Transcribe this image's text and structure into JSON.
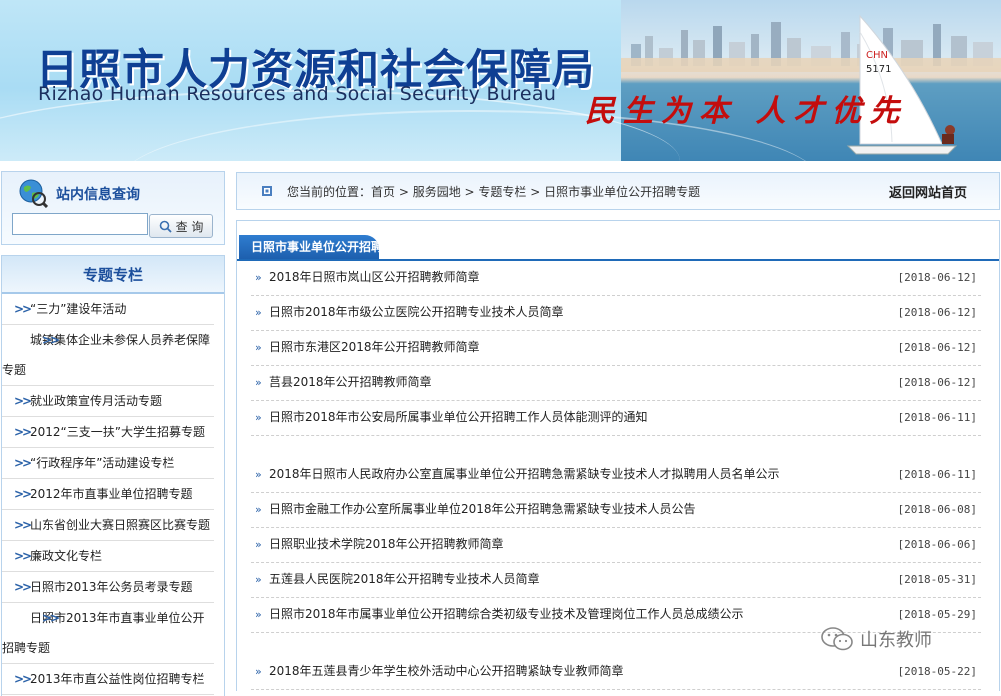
{
  "banner": {
    "title_cn": "日照市人力资源和社会保障局",
    "title_en": "Rizhao Human Resources and Social Security Bureau",
    "slogan": "民生为本 人才优先",
    "sail_text": "CHN 5171"
  },
  "search": {
    "title": "站内信息查询",
    "input_value": "",
    "button_label": "查 询"
  },
  "topics": {
    "header": "专题专栏",
    "items": [
      {
        "label": "“三力”建设年活动"
      },
      {
        "label": "城镇集体企业未参保人员养老保障专题"
      },
      {
        "label": "就业政策宣传月活动专题"
      },
      {
        "label": "2012“三支一扶”大学生招募专题"
      },
      {
        "label": "“行政程序年”活动建设专栏"
      },
      {
        "label": "2012年市直事业单位招聘专题"
      },
      {
        "label": "山东省创业大赛日照赛区比赛专题"
      },
      {
        "label": "廉政文化专栏"
      },
      {
        "label": "日照市2013年公务员考录专题"
      },
      {
        "label": "日照市2013年市直事业单位公开招聘专题"
      },
      {
        "label": "2013年市直公益性岗位招聘专栏"
      }
    ]
  },
  "breadcrumb": {
    "prefix": "您当前的位置：",
    "items": [
      "首页",
      "服务园地",
      "专题专栏",
      "日照市事业单位公开招聘专题"
    ],
    "separator": " > ",
    "back_home": "返回网站首页"
  },
  "content": {
    "tab_label": "日照市事业单位公开招聘",
    "news": [
      {
        "title": "2018年日照市岚山区公开招聘教师简章",
        "date": "[2018-06-12]"
      },
      {
        "title": "日照市2018年市级公立医院公开招聘专业技术人员简章",
        "date": "[2018-06-12]"
      },
      {
        "title": "日照市东港区2018年公开招聘教师简章",
        "date": "[2018-06-12]"
      },
      {
        "title": "莒县2018年公开招聘教师简章",
        "date": "[2018-06-12]"
      },
      {
        "title": "日照市2018年市公安局所属事业单位公开招聘工作人员体能测评的通知",
        "date": "[2018-06-11]"
      },
      {
        "title": "2018年日照市人民政府办公室直属事业单位公开招聘急需紧缺专业技术人才拟聘用人员名单公示",
        "date": "[2018-06-11]"
      },
      {
        "title": "日照市金融工作办公室所属事业单位2018年公开招聘急需紧缺专业技术人员公告",
        "date": "[2018-06-08]"
      },
      {
        "title": "日照职业技术学院2018年公开招聘教师简章",
        "date": "[2018-06-06]"
      },
      {
        "title": "五莲县人民医院2018年公开招聘专业技术人员简章",
        "date": "[2018-05-31]"
      },
      {
        "title": "日照市2018年市属事业单位公开招聘综合类初级专业技术及管理岗位工作人员总成绩公示",
        "date": "[2018-05-29]"
      },
      {
        "title": "2018年五莲县青少年学生校外活动中心公开招聘紧缺专业教师简章",
        "date": "[2018-05-22]"
      }
    ]
  },
  "watermark": {
    "label": "山东教师"
  },
  "colors": {
    "brand_blue": "#0f3f93",
    "slogan_red": "#c40d0d",
    "tab_blue": "#1f6ab8"
  }
}
